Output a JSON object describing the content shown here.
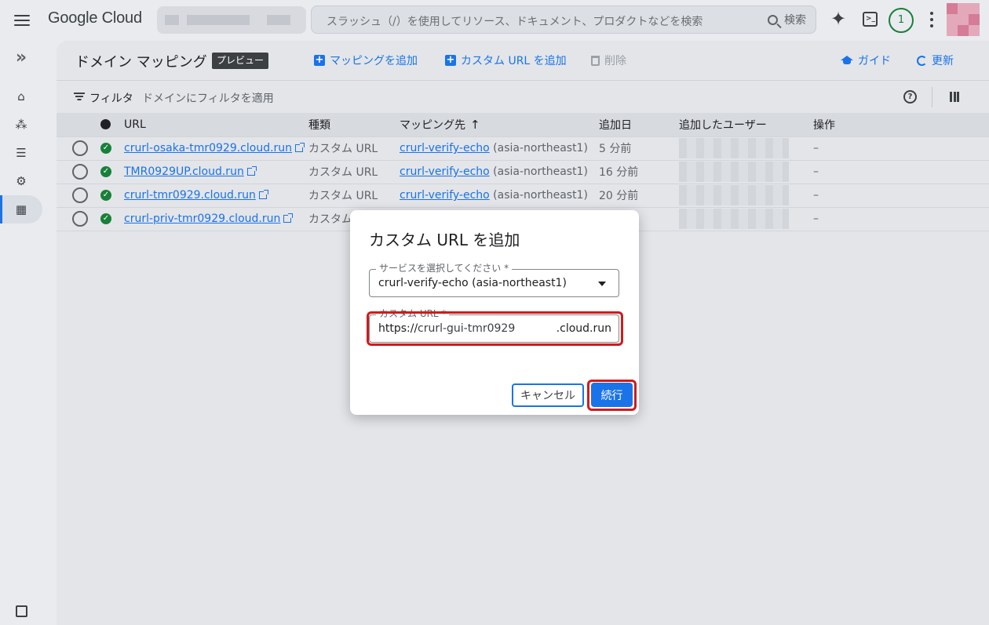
{
  "app": {
    "logo": "Google Cloud",
    "search_placeholder": "スラッシュ（/）を使用してリソース、ドキュメント、プロダクトなどを検索",
    "search_button": "検索",
    "notification_count": "1"
  },
  "header": {
    "title": "ドメイン マッピング",
    "badge": "プレビュー",
    "add_mapping": "マッピングを追加",
    "add_custom_url": "カスタム URL を追加",
    "delete": "削除",
    "guide": "ガイド",
    "refresh": "更新"
  },
  "filter": {
    "label": "フィルタ",
    "placeholder": "ドメインにフィルタを適用"
  },
  "table": {
    "columns": {
      "url": "URL",
      "type": "種類",
      "mapping": "マッピング先",
      "added": "追加日",
      "added_by": "追加したユーザー",
      "actions": "操作"
    },
    "rows": [
      {
        "url": "crurl-osaka-tmr0929.cloud.run",
        "type": "カスタム URL",
        "service": "crurl-verify-echo",
        "region": "(asia-northeast1)",
        "added": "5 分前",
        "actions": "–"
      },
      {
        "url": "TMR0929UP.cloud.run",
        "type": "カスタム URL",
        "service": "crurl-verify-echo",
        "region": "(asia-northeast1)",
        "added": "16 分前",
        "actions": "–"
      },
      {
        "url": "crurl-tmr0929.cloud.run",
        "type": "カスタム URL",
        "service": "crurl-verify-echo",
        "region": "(asia-northeast1)",
        "added": "20 分前",
        "actions": "–"
      },
      {
        "url": "crurl-priv-tmr0929.cloud.run",
        "type": "カスタム",
        "service": "",
        "region": "",
        "added": "",
        "actions": "–"
      }
    ]
  },
  "dialog": {
    "title": "カスタム URL を追加",
    "service_label": "サービスを選択してください *",
    "service_value": "crurl-verify-echo (asia-northeast1)",
    "url_label": "カスタム URL *",
    "url_prefix": "https://",
    "url_value": "crurl-gui-tmr0929",
    "url_suffix": ".cloud.run",
    "cancel": "キャンセル",
    "continue": "続行"
  },
  "colors": {
    "accent": "#1a73e8",
    "success": "#188038",
    "highlight": "#d21a1a"
  }
}
